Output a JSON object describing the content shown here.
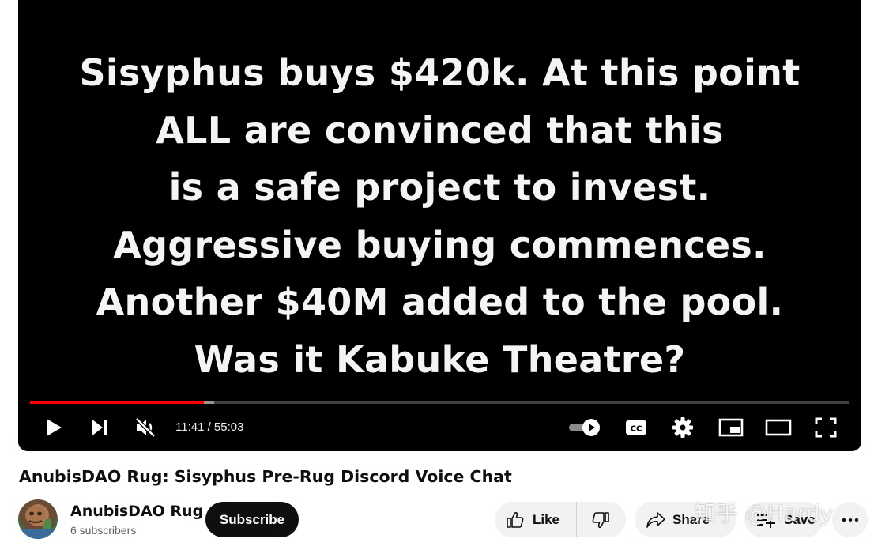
{
  "player": {
    "subtitle_lines": [
      "Sisyphus buys $420k. At this point",
      "ALL are convinced that this",
      "is a safe project to invest.",
      "Aggressive buying commences.",
      "Another $40M added to the pool.",
      "Was it Kabuke Theatre?"
    ],
    "time_display": "11:41 / 55:03",
    "progress_played_fraction": 0.212,
    "progress_buffered_fraction": 0.225,
    "accent_color": "#ff0000",
    "icons": {
      "play": "play-icon",
      "next": "next-icon",
      "mute": "muted-volume-icon",
      "autoplay": "autoplay-toggle-icon",
      "captions": "cc-icon",
      "settings": "gear-icon",
      "miniplayer": "miniplayer-icon",
      "theater": "theater-mode-icon",
      "fullscreen": "fullscreen-icon"
    },
    "captions_label": "CC"
  },
  "video": {
    "title": "AnubisDAO Rug: Sisyphus Pre-Rug Discord Voice Chat"
  },
  "channel": {
    "name": "AnubisDAO Rug",
    "subscribers": "6 subscribers",
    "subscribe_label": "Subscribe"
  },
  "actions": {
    "like_label": "Like",
    "share_label": "Share",
    "save_label": "Save"
  },
  "watermark": "知乎 @Hardy"
}
